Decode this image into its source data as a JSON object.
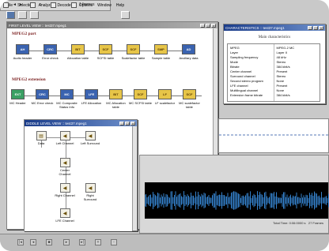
{
  "menu": [
    "File",
    "Selection",
    "Analyze",
    "Decoders",
    "Options",
    "Window",
    "Help"
  ],
  "first_view": {
    "title": "FIRST LEVEL VIEW :: test37.mpeg1",
    "mpeg2_part_label": "MPEG2 part",
    "mpeg2_items": [
      {
        "icon": "AH",
        "color": "b",
        "label": "Audio header"
      },
      {
        "icon": "CRC",
        "color": "b",
        "label": "Error check"
      },
      {
        "icon": "BIT",
        "color": "y",
        "label": "Allocation table"
      },
      {
        "icon": "SCF",
        "color": "y",
        "label": "SCFSI table"
      },
      {
        "icon": "SCF",
        "color": "y",
        "label": "Scalefactor table"
      },
      {
        "icon": "SMP",
        "color": "y",
        "label": "Sample table"
      },
      {
        "icon": "AD",
        "color": "b",
        "label": "Ancillary data"
      }
    ],
    "mpeg2_ext_label": "MPEG2 extension",
    "ext_items": [
      {
        "icon": "EXT",
        "color": "g",
        "label": "MC Header"
      },
      {
        "icon": "CRC",
        "color": "b",
        "label": "MC Error check"
      },
      {
        "icon": "MC",
        "color": "b",
        "label": "MC Composite Status Info"
      },
      {
        "icon": "LFE",
        "color": "b",
        "label": "LFE Allocation"
      },
      {
        "icon": "BIT",
        "color": "y",
        "label": "MC Allocation table"
      },
      {
        "icon": "SCF",
        "color": "y",
        "label": "MC SCFSI table"
      },
      {
        "icon": "LF",
        "color": "y",
        "label": "LF scalefactor"
      },
      {
        "icon": "SCF",
        "color": "y",
        "label": "MC scalefactor table"
      }
    ]
  },
  "channel_view": {
    "title": "DIDDLE LEVEL VIEW :: test37.mpeg1",
    "nodes": {
      "data": "Data",
      "left_channel": "Left Channel",
      "left_surround": "Left Surround",
      "center_channel": "Center Channel",
      "right_channel": "Right Channel",
      "right_surround": "Right Surround",
      "lfe_channel": "LFE Channel"
    }
  },
  "characteristics": {
    "title": "CHARACTERISTICS :: test37.mpeg1",
    "heading": "Main characteristics",
    "left_col": [
      "MPEG",
      "Layer",
      "Sampling frequency",
      "Mode",
      "Bitrate",
      "Center channel",
      "Surround channel",
      "Second stereo program",
      "LFE channel",
      "Multilingual channel",
      "Extension frame bitrate"
    ],
    "right_col": [
      "MPEG-2 MC",
      "Layer II",
      "48 kHz",
      "Stereo",
      "384 kbit/s",
      "Present",
      "Stereo",
      "None",
      "Present",
      "None",
      "384 kbit/s"
    ]
  },
  "controls": {
    "frame_label": "1 frames",
    "nav_left": "◄",
    "nav_right": "►"
  },
  "status": {
    "total_time": "Total Time: 0:06:0000 s",
    "frames": "27 Frames"
  },
  "colors": {
    "accent": "#1a3c8a",
    "waveform": "#3a8fe0",
    "panel": "#000000"
  }
}
